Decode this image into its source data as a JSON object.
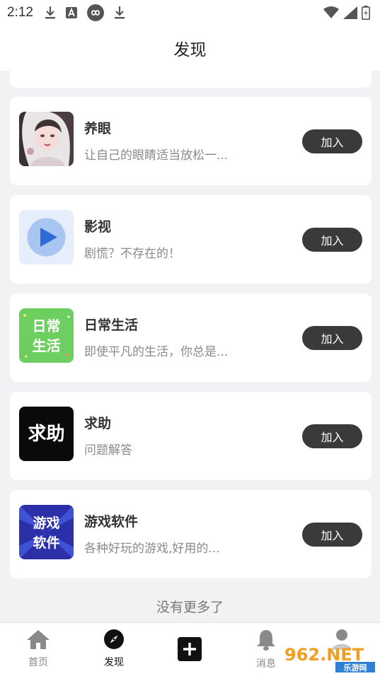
{
  "status_bar": {
    "time": "2:12",
    "left_icons": [
      "download-icon",
      "a-box-icon",
      "infinity-icon",
      "download-icon"
    ],
    "right_icons": [
      "wifi-icon",
      "signal-icon",
      "battery-icon"
    ]
  },
  "header": {
    "title": "发现"
  },
  "cards": [
    {
      "title": "养眼",
      "description": "让自己的眼睛适当放松一...",
      "button": "加入",
      "icon": "portrait-avatar"
    },
    {
      "title": "影视",
      "description": "剧慌？不存在的！",
      "button": "加入",
      "icon": "play-icon"
    },
    {
      "title": "日常生活",
      "description": "即使平凡的生活，你总是...",
      "button": "加入",
      "icon": "daily-life-icon",
      "icon_text": [
        "日常",
        "生活"
      ]
    },
    {
      "title": "求助",
      "description": "问题解答",
      "button": "加入",
      "icon": "help-icon",
      "icon_text": "求助"
    },
    {
      "title": "游戏软件",
      "description": "各种好玩的游戏,好用的...",
      "button": "加入",
      "icon": "game-software-icon",
      "icon_text": [
        "游戏",
        "软件"
      ]
    }
  ],
  "footer_text": "没有更多了",
  "bottom_nav": [
    {
      "label": "首页",
      "icon": "home-icon",
      "active": false
    },
    {
      "label": "发现",
      "icon": "compass-icon",
      "active": true
    },
    {
      "label": "",
      "icon": "add-icon",
      "active": false
    },
    {
      "label": "消息",
      "icon": "bell-icon",
      "active": false
    },
    {
      "label": "",
      "icon": "profile-icon",
      "active": false
    }
  ],
  "watermark": {
    "text": "962.NET",
    "subtext": "乐游网"
  },
  "colors": {
    "button_bg": "#3a3a3a",
    "page_bg": "#f2f2f4",
    "card_bg": "#ffffff"
  }
}
